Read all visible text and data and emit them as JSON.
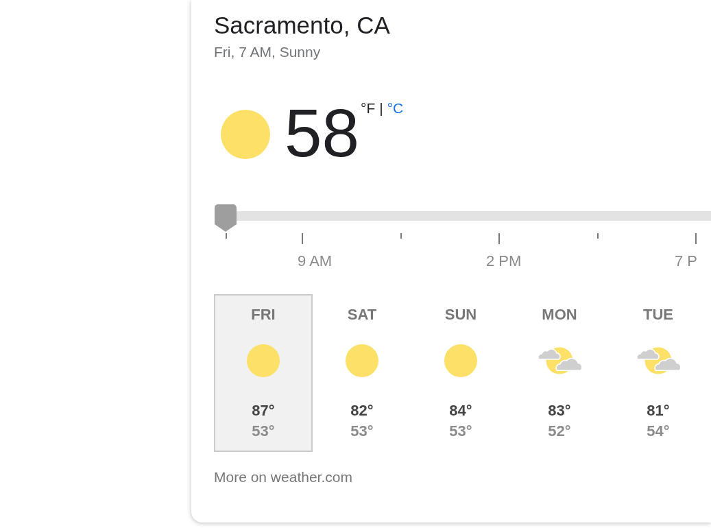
{
  "location": {
    "name": "Sacramento, CA",
    "summary": "Fri, 7 AM, Sunny"
  },
  "current": {
    "kind": "sun",
    "temperature": "58",
    "units": [
      {
        "label": "°F",
        "selected": true
      },
      {
        "label": "°C",
        "selected": false
      }
    ],
    "unit_separator": "|"
  },
  "timeline": {
    "level": 0,
    "ticks": [
      {
        "kind": "minor"
      },
      {
        "kind": "major"
      },
      {
        "kind": "minor"
      },
      {
        "kind": "major"
      },
      {
        "kind": "minor"
      },
      {
        "kind": "major"
      }
    ],
    "labels": [
      "9 AM",
      "2 PM",
      "7 P"
    ]
  },
  "forecast": [
    {
      "day": "FRI",
      "kind": "sun",
      "high": "87°",
      "low": "53°",
      "selected": true
    },
    {
      "day": "SAT",
      "kind": "sun",
      "high": "82°",
      "low": "53°",
      "selected": false
    },
    {
      "day": "SUN",
      "kind": "sun",
      "high": "84°",
      "low": "53°",
      "selected": false
    },
    {
      "day": "MON",
      "kind": "partly-cloudy",
      "high": "83°",
      "low": "52°",
      "selected": false
    },
    {
      "day": "TUE",
      "kind": "partly-cloudy",
      "high": "81°",
      "low": "54°",
      "selected": false
    }
  ],
  "more_link": "More on weather.com"
}
